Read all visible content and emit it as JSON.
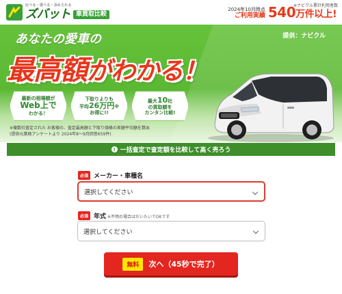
{
  "header": {
    "tagline": "比べる・選べる・決められる",
    "brand": "ズバット",
    "badge": "車買取比較",
    "date_note": "2024年10月時点",
    "source_note": "※ナビクル累計利用者数",
    "usage_label": "ご利用実績",
    "usage_value": "540",
    "usage_unit": "万件以上!"
  },
  "hero": {
    "subtitle": "あなたの愛車の",
    "provider": "提供：ナビクル",
    "headline_strong": "最高額",
    "headline_rest": "がわかる！",
    "features": [
      {
        "line1": "最新の相場額が",
        "line2": "Web上で",
        "line3": "わかる！"
      },
      {
        "line1": "下取りよりも",
        "line2a": "平均",
        "line2b": "26万円",
        "line2c": "※",
        "line3": "お得に!!"
      },
      {
        "line1a": "最大",
        "line1b": "10",
        "line1c": "社",
        "line2": "の買取額を",
        "line3": "カンタン比較!"
      }
    ],
    "footnote1": "※複数社査定された お客様の、査定最高額と下取り価格の差額平均額を算出",
    "footnote2": "(提供元業務アンケートより 2024年8〜9月回答659件)"
  },
  "bar": {
    "icon": "!",
    "text": "一括査定で査定額を比較して高く売ろう"
  },
  "form": {
    "maker": {
      "required": "必須",
      "label": "メーカー・車種名",
      "placeholder": "選択してください"
    },
    "year": {
      "required": "必須",
      "label": "年式",
      "hint": "※不明の場合はだいたいでOKです",
      "placeholder": "選択してください"
    },
    "cta": {
      "badge": "無料",
      "label": "次へ（45秒で完了）"
    }
  },
  "colors": {
    "brand_green": "#3e8e2a",
    "hero_green": "#5bb833",
    "accent_red": "#e3261f",
    "badge_yellow": "#ffe600"
  }
}
